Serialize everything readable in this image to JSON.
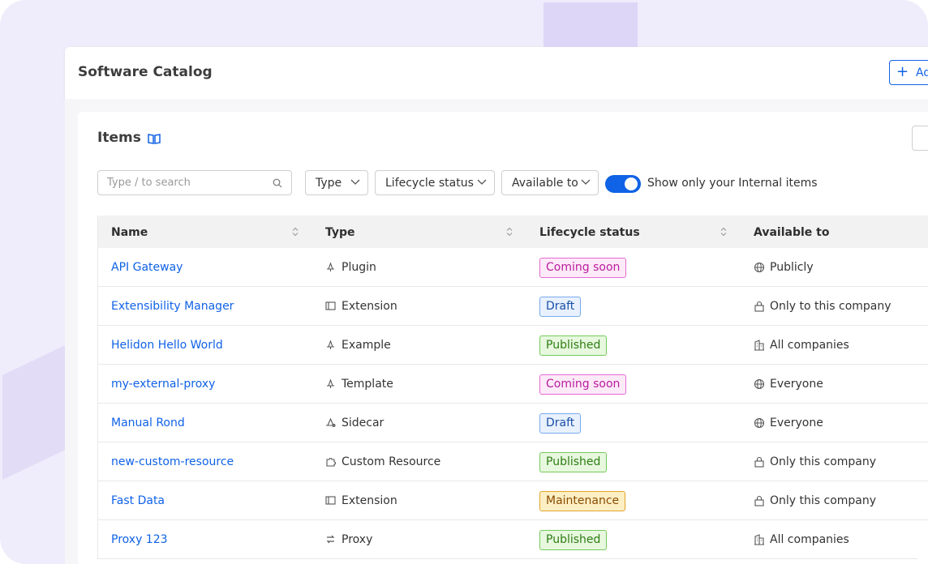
{
  "header": {
    "title": "Software Catalog",
    "add_label": "Ad"
  },
  "items": {
    "title": "Items"
  },
  "filters": {
    "search_placeholder": "Type / to search",
    "type_label": "Type",
    "lifecycle_label": "Lifecycle status",
    "available_label": "Available to",
    "toggle_label": "Show only your Internal items",
    "toggle_on": true
  },
  "table": {
    "columns": [
      "Name",
      "Type",
      "Lifecycle status",
      "Available to"
    ],
    "rows": [
      {
        "name": "API Gateway",
        "type": "Plugin",
        "type_icon": "plugin-icon",
        "status": "Coming soon",
        "status_kind": "coming",
        "available": "Publicly",
        "available_icon": "globe-icon"
      },
      {
        "name": "Extensibility Manager",
        "type": "Extension",
        "type_icon": "extension-icon",
        "status": "Draft",
        "status_kind": "draft",
        "available": "Only to this company",
        "available_icon": "lock-icon"
      },
      {
        "name": "Helidon Hello World",
        "type": "Example",
        "type_icon": "plugin-icon",
        "status": "Published",
        "status_kind": "published",
        "available": "All companies",
        "available_icon": "building-icon"
      },
      {
        "name": "my-external-proxy",
        "type": "Template",
        "type_icon": "plugin-icon",
        "status": "Coming soon",
        "status_kind": "coming",
        "available": "Everyone",
        "available_icon": "globe-icon"
      },
      {
        "name": "Manual Rond",
        "type": "Sidecar",
        "type_icon": "sidecar-icon",
        "status": "Draft",
        "status_kind": "draft",
        "available": "Everyone",
        "available_icon": "globe-icon"
      },
      {
        "name": "new-custom-resource",
        "type": "Custom Resource",
        "type_icon": "puzzle-icon",
        "status": "Published",
        "status_kind": "published",
        "available": "Only this company",
        "available_icon": "lock-icon"
      },
      {
        "name": "Fast Data",
        "type": "Extension",
        "type_icon": "extension-icon",
        "status": "Maintenance",
        "status_kind": "maintenance",
        "available": "Only this company",
        "available_icon": "lock-icon"
      },
      {
        "name": "Proxy 123",
        "type": "Proxy",
        "type_icon": "swap-icon",
        "status": "Published",
        "status_kind": "published",
        "available": "All companies",
        "available_icon": "building-icon"
      }
    ]
  },
  "colors": {
    "accent": "#1062e6",
    "coming_bg": "#fdeaf8",
    "coming_border": "#e56ad2",
    "coming_text": "#b91d9e",
    "draft_bg": "#e8f1fd",
    "draft_border": "#7aa9ef",
    "draft_text": "#1a4fa8",
    "published_bg": "#e7f8df",
    "published_border": "#74c95a",
    "published_text": "#2f7d14",
    "maintenance_bg": "#fdefc4",
    "maintenance_border": "#e1a42a",
    "maintenance_text": "#8a4c00"
  }
}
